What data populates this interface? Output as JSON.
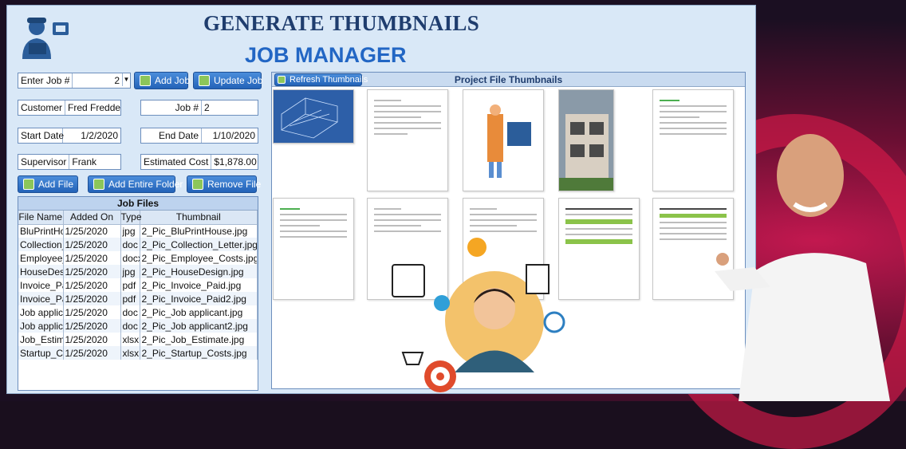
{
  "title_line1": "GENERATE THUMBNAILS",
  "title_line2": "JOB MANAGER",
  "enter_job": {
    "label": "Enter Job #",
    "value": "2"
  },
  "buttons": {
    "add_job": "Add Job",
    "update_job": "Update Job",
    "refresh": "Refresh Thumbnails",
    "add_file": "Add File",
    "add_folder": "Add Entire Folder",
    "remove_file": "Remove File"
  },
  "fields": {
    "customer": {
      "label": "Customer",
      "value": "Fred Fredders"
    },
    "job_num": {
      "label": "Job #",
      "value": "2"
    },
    "start_date": {
      "label": "Start Date",
      "value": "1/2/2020"
    },
    "end_date": {
      "label": "End Date",
      "value": "1/10/2020"
    },
    "supervisor": {
      "label": "Supervisor",
      "value": "Frank"
    },
    "est_cost": {
      "label": "Estimated Cost",
      "value": "$1,878.00"
    }
  },
  "job_files": {
    "title": "Job Files",
    "columns": [
      "File Name",
      "Added On",
      "Type",
      "Thumbnail"
    ],
    "rows": [
      [
        "BluPrintHou",
        "1/25/2020",
        "jpg",
        "2_Pic_BluPrintHouse.jpg"
      ],
      [
        "Collection_",
        "1/25/2020",
        "doc",
        "2_Pic_Collection_Letter.jpg"
      ],
      [
        "Employee_",
        "1/25/2020",
        "docx",
        "2_Pic_Employee_Costs.jpg"
      ],
      [
        "HouseDesig",
        "1/25/2020",
        "jpg",
        "2_Pic_HouseDesign.jpg"
      ],
      [
        "Invoice_Pai",
        "1/25/2020",
        "pdf",
        "2_Pic_Invoice_Paid.jpg"
      ],
      [
        "Invoice_Pai",
        "1/25/2020",
        "pdf",
        "2_Pic_Invoice_Paid2.jpg"
      ],
      [
        "Job applicai",
        "1/25/2020",
        "doc",
        "2_Pic_Job applicant.jpg"
      ],
      [
        "Job applicai",
        "1/25/2020",
        "doc",
        "2_Pic_Job applicant2.jpg"
      ],
      [
        "Job_Estima",
        "1/25/2020",
        "xlsx",
        "2_Pic_Job_Estimate.jpg"
      ],
      [
        "Startup_Co:",
        "1/25/2020",
        "xlsx",
        "2_Pic_Startup_Costs.jpg"
      ]
    ]
  },
  "project_thumbnails": {
    "title": "Project File Thumbnails"
  },
  "colors": {
    "accent": "#2266c4",
    "title": "#1f3d6e",
    "button": "#2363b8",
    "brand_red": "#d51a4a"
  }
}
